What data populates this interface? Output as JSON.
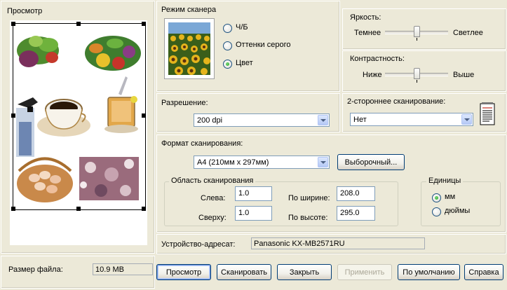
{
  "preview": {
    "title": "Просмотр"
  },
  "scanmode": {
    "title": "Режим сканера",
    "options": [
      {
        "label": "Ч/Б",
        "selected": false
      },
      {
        "label": "Оттенки серого",
        "selected": false
      },
      {
        "label": "Цвет",
        "selected": true
      }
    ]
  },
  "brightness": {
    "title": "Яркость:",
    "left": "Темнее",
    "right": "Светлее",
    "level_percent": 50
  },
  "contrast": {
    "title": "Контрастность:",
    "left": "Ниже",
    "right": "Выше",
    "level_percent": 50
  },
  "resolution": {
    "title": "Разрешение:",
    "value": "200 dpi"
  },
  "duplex": {
    "title": "2-стороннее сканирование:",
    "value": "Нет"
  },
  "format": {
    "title": "Формат сканирования:",
    "value": "A4 (210мм x 297мм)",
    "custom_button": "Выборочный..."
  },
  "area": {
    "title": "Область сканирования",
    "left_label": "Слева:",
    "left_value": "1.0",
    "top_label": "Сверху:",
    "top_value": "1.0",
    "width_label": "По ширине:",
    "width_value": "208.0",
    "height_label": "По высоте:",
    "height_value": "295.0"
  },
  "units": {
    "title": "Единицы",
    "options": [
      {
        "label": "мм",
        "selected": true
      },
      {
        "label": "дюймы",
        "selected": false
      }
    ]
  },
  "destination": {
    "label": "Устройство-адресат:",
    "value": "Panasonic KX-MB2571RU"
  },
  "filesize": {
    "label": "Размер файла:",
    "value": "10.9 MB"
  },
  "buttons": {
    "preview": "Просмотр",
    "scan": "Сканировать",
    "close": "Закрыть",
    "apply": "Применить",
    "defaults": "По умолчанию",
    "help": "Справка"
  },
  "colors": {
    "accent_blue": "#003c74",
    "window_bg": "#ece9d8",
    "radio_dot": "#21a121"
  }
}
